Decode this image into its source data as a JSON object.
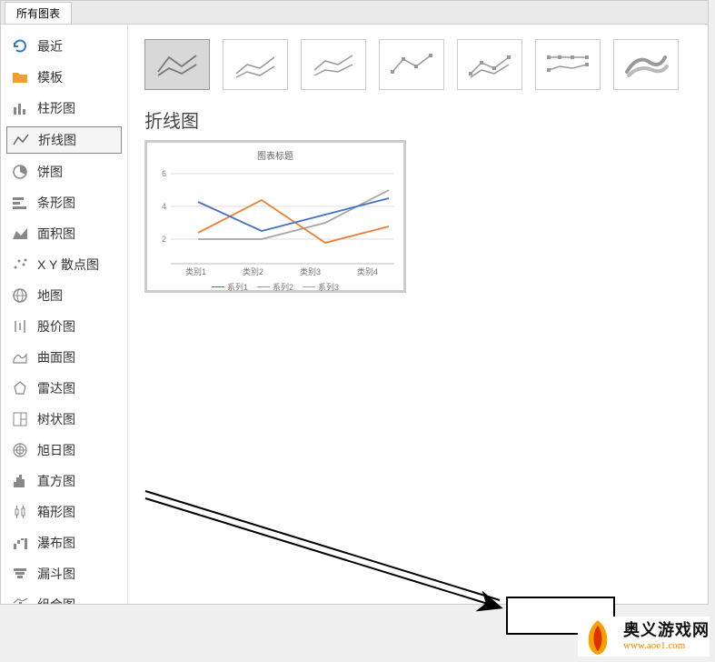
{
  "tab_label": "所有图表",
  "sidebar": {
    "items": [
      {
        "label": "最近"
      },
      {
        "label": "模板"
      },
      {
        "label": "柱形图"
      },
      {
        "label": "折线图"
      },
      {
        "label": "饼图"
      },
      {
        "label": "条形图"
      },
      {
        "label": "面积图"
      },
      {
        "label": "X Y 散点图"
      },
      {
        "label": "地图"
      },
      {
        "label": "股价图"
      },
      {
        "label": "曲面图"
      },
      {
        "label": "雷达图"
      },
      {
        "label": "树状图"
      },
      {
        "label": "旭日图"
      },
      {
        "label": "直方图"
      },
      {
        "label": "箱形图"
      },
      {
        "label": "瀑布图"
      },
      {
        "label": "漏斗图"
      },
      {
        "label": "组合图"
      }
    ]
  },
  "section_title": "折线图",
  "chart_data": {
    "type": "line",
    "title": "图表标题",
    "categories": [
      "类别1",
      "类别2",
      "类别3",
      "类别4"
    ],
    "ylim": [
      0,
      6
    ],
    "yticks": [
      2,
      4,
      6
    ],
    "series": [
      {
        "name": "系列1",
        "color": "#4472c4",
        "values": [
          4.3,
          2.5,
          3.5,
          4.5
        ]
      },
      {
        "name": "系列2",
        "color": "#ed7d31",
        "values": [
          2.4,
          4.4,
          1.8,
          2.8
        ]
      },
      {
        "name": "系列3",
        "color": "#a5a5a5",
        "values": [
          2.0,
          2.0,
          3.0,
          5.0
        ]
      }
    ]
  },
  "watermark": {
    "cn": "奥义游戏网",
    "url": "www.aoe1.com"
  }
}
